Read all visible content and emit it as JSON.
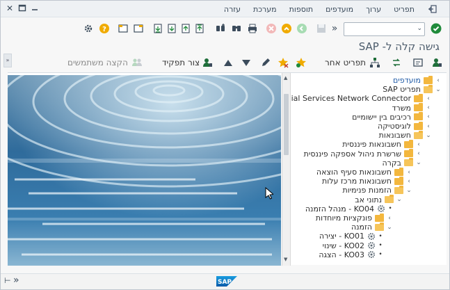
{
  "menu": {
    "items": [
      "תפריט",
      "ערוך",
      "מועדפים",
      "תוספות",
      "מערכת",
      "עזרה"
    ]
  },
  "window_controls": [
    "close-icon",
    "maximize-icon",
    "minimize-icon"
  ],
  "toolbar": {
    "command_field_value": "",
    "icons": [
      "enter-checkmark-icon",
      "save-icon",
      "back-icon",
      "exit-icon",
      "cancel-icon",
      "print-icon",
      "find-icon",
      "find-next-icon",
      "first-page-icon",
      "previous-page-icon",
      "next-page-icon",
      "last-page-icon",
      "create-session-icon",
      "shortcut-icon",
      "help-icon",
      "customize-layout-icon"
    ]
  },
  "title": "גישה קלה ל- SAP",
  "app_toolbar": {
    "other_menu": "תפריט אחר",
    "create_role": "צור תפקיד",
    "assign_users": "הקצה משתמשים"
  },
  "tree": [
    {
      "label": "מועדפים",
      "chev": "‹",
      "folder": "closed",
      "blue": true
    },
    {
      "label": "תפריט SAP",
      "chev": "⌄",
      "folder": "open",
      "blue": false
    },
    {
      "label": "Financial Services Network Connector",
      "chev": "‹",
      "folder": "closed",
      "blue": false
    },
    {
      "label": "משרד",
      "chev": "‹",
      "folder": "closed",
      "blue": false
    },
    {
      "label": "רכיבים בין יישומיים",
      "chev": "‹",
      "folder": "closed",
      "blue": false
    },
    {
      "label": "לוגיסטיקה",
      "chev": "‹",
      "folder": "closed",
      "blue": false
    },
    {
      "label": "חשבונאות",
      "chev": "⌄",
      "folder": "open",
      "blue": false
    },
    {
      "label": "חשבונאות פיננסית",
      "chev": "‹",
      "folder": "closed",
      "blue": false
    },
    {
      "label": "שרשרת ניהול אספקה פיננסית",
      "chev": "‹",
      "folder": "closed",
      "blue": false
    },
    {
      "label": "בקרה",
      "chev": "⌄",
      "folder": "open",
      "blue": false
    },
    {
      "label": "חשבונאות סעיף הוצאה",
      "chev": "‹",
      "folder": "closed",
      "blue": false
    },
    {
      "label": "חשבונאות מרכז עלות",
      "chev": "‹",
      "folder": "closed",
      "blue": false
    },
    {
      "label": "הזמנות פנימיות",
      "chev": "⌄",
      "folder": "open",
      "blue": false
    },
    {
      "label": "נתוני אב",
      "chev": "⌄",
      "folder": "open",
      "blue": false
    },
    {
      "label": "KO04 - מנהל הזמנה",
      "chev": "•",
      "folder": "gear",
      "blue": false
    },
    {
      "label": "פונקציות מיוחדות",
      "chev": "‹",
      "folder": "closed",
      "blue": false
    },
    {
      "label": "הזמנה",
      "chev": "⌄",
      "folder": "open",
      "blue": false
    },
    {
      "label": "KO01 - יצירה",
      "chev": "•",
      "folder": "gear",
      "blue": false
    },
    {
      "label": "KO02 - שינוי",
      "chev": "•",
      "folder": "gear",
      "blue": false
    },
    {
      "label": "KO03 - הצגה",
      "chev": "•",
      "folder": "gear",
      "blue": false
    }
  ],
  "statusbar": {
    "logo_text": "SAP"
  }
}
